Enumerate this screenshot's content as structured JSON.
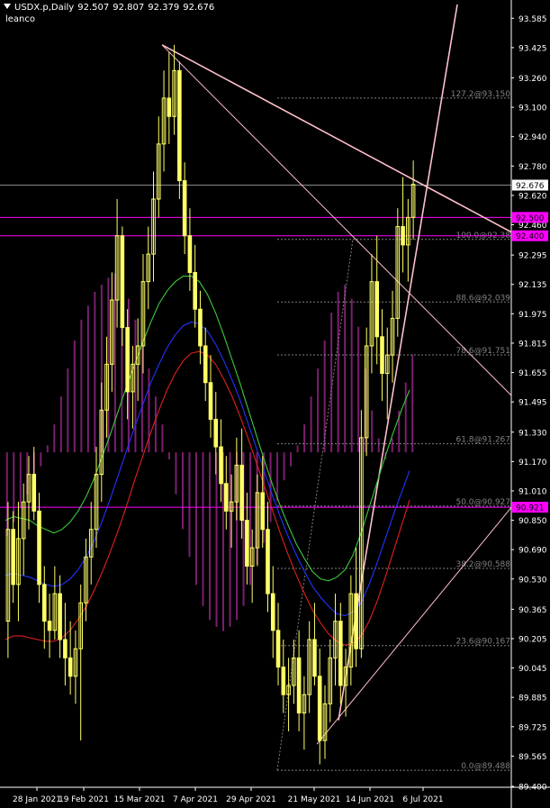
{
  "header": {
    "symbol": "USDX.p,Daily",
    "ohlc": [
      "92.507",
      "92.807",
      "92.379",
      "92.676"
    ],
    "indicator": "leanco"
  },
  "colors": {
    "background": "#000000",
    "candle": "#ffff66",
    "histogram": "#7a1f6e",
    "ma_fast": "#3cc83c",
    "ma_mid": "#2233ff",
    "ma_slow": "#e02020",
    "trendline": "#ffc0cb",
    "fib": "#808080",
    "hline": "#ff00ff",
    "axis": "#ffffff"
  },
  "chart_data": {
    "type": "candlestick",
    "title": "USDX.p,Daily",
    "xlabel": "",
    "ylabel": "",
    "ylim": [
      89.4,
      93.66
    ],
    "grid": false,
    "y_ticks": [
      "93.585",
      "93.425",
      "93.260",
      "93.100",
      "92.940",
      "92.780",
      "92.620",
      "92.460",
      "92.295",
      "92.135",
      "91.975",
      "91.815",
      "91.655",
      "91.495",
      "91.330",
      "91.170",
      "91.010",
      "90.850",
      "90.690",
      "90.530",
      "90.365",
      "90.205",
      "90.045",
      "89.885",
      "89.725",
      "89.565",
      "89.400"
    ],
    "x_ticks": [
      "28 Jan 2021",
      "19 Feb 2021",
      "15 Mar 2021",
      "7 Apr 2021",
      "29 Apr 2021",
      "21 May 2021",
      "14 Jun 2021",
      "6 Jul 2021"
    ],
    "current_price": "92.676",
    "price_lines": [
      {
        "label": "92.500",
        "value": 92.5
      },
      {
        "label": "92.400",
        "value": 92.4
      },
      {
        "label": "90.921",
        "value": 90.921
      }
    ],
    "fib_levels": [
      {
        "label": "127.2@93.150",
        "value": 93.15
      },
      {
        "label": "100.0@92.38",
        "value": 92.38
      },
      {
        "label": "88.6@92.039",
        "value": 92.039
      },
      {
        "label": "78.6@91.751",
        "value": 91.751
      },
      {
        "label": "61.8@91.267",
        "value": 91.267
      },
      {
        "label": "50.0@90.927",
        "value": 90.927
      },
      {
        "label": "38.2@90.588",
        "value": 90.588
      },
      {
        "label": "23.6@90.167",
        "value": 90.167
      },
      {
        "label": "0.0@89.488",
        "value": 89.488
      }
    ],
    "candles": [
      [
        90.3,
        90.95,
        90.1,
        90.8
      ],
      [
        90.8,
        90.9,
        90.4,
        90.5
      ],
      [
        90.5,
        90.95,
        90.3,
        90.75
      ],
      [
        90.75,
        91.05,
        90.55,
        90.95
      ],
      [
        90.95,
        91.2,
        90.8,
        91.1
      ],
      [
        91.1,
        91.25,
        90.85,
        90.9
      ],
      [
        90.9,
        91.0,
        90.4,
        90.5
      ],
      [
        90.5,
        90.6,
        90.15,
        90.3
      ],
      [
        90.3,
        90.45,
        90.1,
        90.25
      ],
      [
        90.25,
        90.6,
        90.2,
        90.45
      ],
      [
        90.45,
        90.55,
        90.1,
        90.2
      ],
      [
        90.2,
        90.4,
        89.95,
        90.1
      ],
      [
        90.1,
        90.3,
        89.9,
        90.0
      ],
      [
        90.0,
        90.25,
        89.85,
        90.15
      ],
      [
        90.15,
        90.5,
        89.65,
        90.4
      ],
      [
        90.4,
        90.75,
        90.3,
        90.65
      ],
      [
        90.65,
        90.95,
        90.5,
        90.8
      ],
      [
        90.8,
        91.25,
        90.7,
        91.1
      ],
      [
        91.1,
        91.6,
        90.95,
        91.45
      ],
      [
        91.45,
        91.85,
        91.3,
        91.7
      ],
      [
        91.7,
        92.2,
        91.55,
        92.05
      ],
      [
        92.05,
        92.6,
        91.9,
        92.4
      ],
      [
        92.4,
        92.45,
        91.8,
        91.9
      ],
      [
        91.9,
        92.0,
        91.4,
        91.55
      ],
      [
        91.55,
        91.8,
        91.35,
        91.7
      ],
      [
        91.7,
        91.95,
        91.5,
        91.8
      ],
      [
        91.8,
        92.3,
        91.65,
        92.15
      ],
      [
        92.15,
        92.45,
        92.0,
        92.3
      ],
      [
        92.3,
        92.75,
        92.15,
        92.6
      ],
      [
        92.6,
        93.05,
        92.5,
        92.9
      ],
      [
        92.9,
        93.3,
        92.75,
        93.15
      ],
      [
        93.15,
        93.4,
        92.9,
        93.05
      ],
      [
        93.05,
        93.44,
        92.95,
        93.3
      ],
      [
        93.3,
        93.35,
        92.6,
        92.7
      ],
      [
        92.7,
        92.8,
        92.3,
        92.4
      ],
      [
        92.4,
        92.55,
        92.1,
        92.2
      ],
      [
        92.2,
        92.35,
        91.9,
        92.0
      ],
      [
        92.0,
        92.1,
        91.7,
        91.8
      ],
      [
        91.8,
        91.9,
        91.5,
        91.6
      ],
      [
        91.6,
        91.75,
        91.3,
        91.4
      ],
      [
        91.4,
        91.55,
        91.1,
        91.25
      ],
      [
        91.25,
        91.4,
        90.95,
        91.05
      ],
      [
        91.05,
        91.2,
        90.8,
        90.9
      ],
      [
        90.9,
        91.1,
        90.7,
        90.95
      ],
      [
        90.95,
        91.3,
        90.85,
        91.15
      ],
      [
        91.15,
        91.35,
        90.75,
        90.85
      ],
      [
        90.85,
        91.0,
        90.5,
        90.6
      ],
      [
        90.6,
        90.8,
        90.4,
        90.7
      ],
      [
        90.7,
        91.1,
        90.6,
        91.0
      ],
      [
        91.0,
        91.2,
        90.7,
        90.8
      ],
      [
        90.8,
        90.95,
        90.35,
        90.45
      ],
      [
        90.45,
        90.6,
        90.1,
        90.25
      ],
      [
        90.25,
        90.4,
        89.95,
        90.05
      ],
      [
        90.05,
        90.2,
        89.8,
        89.9
      ],
      [
        89.9,
        90.1,
        89.7,
        89.95
      ],
      [
        89.95,
        90.2,
        89.85,
        90.1
      ],
      [
        90.1,
        90.25,
        89.7,
        89.8
      ],
      [
        89.8,
        90.0,
        89.6,
        89.9
      ],
      [
        89.9,
        90.3,
        89.8,
        90.2
      ],
      [
        90.2,
        90.4,
        89.95,
        90.0
      ],
      [
        90.0,
        90.15,
        89.52,
        89.65
      ],
      [
        89.65,
        89.95,
        89.55,
        89.85
      ],
      [
        89.85,
        90.2,
        89.75,
        90.1
      ],
      [
        90.1,
        90.45,
        89.95,
        90.3
      ],
      [
        90.3,
        90.4,
        89.85,
        89.95
      ],
      [
        89.95,
        90.15,
        89.78,
        90.05
      ],
      [
        90.05,
        90.55,
        89.95,
        90.45
      ],
      [
        90.45,
        90.7,
        90.05,
        90.15
      ],
      [
        90.15,
        91.45,
        90.1,
        91.3
      ],
      [
        91.3,
        91.9,
        91.2,
        91.8
      ],
      [
        91.8,
        92.3,
        91.65,
        92.15
      ],
      [
        92.15,
        92.4,
        91.7,
        91.85
      ],
      [
        91.85,
        92.0,
        91.5,
        91.65
      ],
      [
        91.65,
        91.9,
        91.4,
        91.75
      ],
      [
        91.75,
        92.1,
        91.6,
        91.95
      ],
      [
        91.95,
        92.55,
        91.85,
        92.45
      ],
      [
        92.45,
        92.72,
        92.2,
        92.35
      ],
      [
        92.35,
        92.6,
        92.15,
        92.5
      ],
      [
        92.5,
        92.81,
        92.38,
        92.68
      ]
    ],
    "series": [
      {
        "values": [
          90.85,
          90.87,
          90.86,
          90.85,
          90.82,
          90.8,
          90.78,
          90.8,
          90.84,
          90.9,
          90.98,
          91.08,
          91.2,
          91.32,
          91.45,
          91.58,
          91.7,
          91.82,
          91.93,
          92.03,
          92.1,
          92.15,
          92.18,
          92.18,
          92.15,
          92.08,
          91.98,
          91.86,
          91.73,
          91.6,
          91.46,
          91.32,
          91.18,
          91.05,
          90.93,
          90.82,
          90.72,
          90.64,
          90.57,
          90.53,
          90.52,
          90.54,
          90.58,
          90.66,
          90.78,
          90.92,
          91.06,
          91.2,
          91.33,
          91.45,
          91.56
        ]
      },
      {
        "values": [
          90.55,
          90.56,
          90.55,
          90.54,
          90.52,
          90.5,
          90.49,
          90.5,
          90.53,
          90.58,
          90.65,
          90.74,
          90.85,
          90.97,
          91.1,
          91.23,
          91.36,
          91.48,
          91.6,
          91.7,
          91.79,
          91.86,
          91.91,
          91.93,
          91.92,
          91.88,
          91.81,
          91.72,
          91.62,
          91.51,
          91.38,
          91.25,
          91.12,
          90.99,
          90.87,
          90.76,
          90.66,
          90.57,
          90.49,
          90.43,
          90.38,
          90.34,
          90.33,
          90.35,
          90.4,
          90.5,
          90.62,
          90.75,
          90.88,
          91.0,
          91.12
        ]
      },
      {
        "values": [
          90.2,
          90.22,
          90.22,
          90.21,
          90.2,
          90.19,
          90.19,
          90.21,
          90.25,
          90.31,
          90.38,
          90.47,
          90.57,
          90.68,
          90.8,
          90.93,
          91.07,
          91.2,
          91.33,
          91.45,
          91.56,
          91.65,
          91.72,
          91.76,
          91.77,
          91.75,
          91.7,
          91.62,
          91.53,
          91.42,
          91.3,
          91.17,
          91.04,
          90.91,
          90.78,
          90.66,
          90.55,
          90.45,
          90.36,
          90.29,
          90.23,
          90.19,
          90.17,
          90.18,
          90.22,
          90.3,
          90.41,
          90.54,
          90.68,
          90.82,
          90.96
        ]
      }
    ],
    "histogram": [
      -0.6,
      -0.5,
      -0.4,
      -0.3,
      -0.2,
      -0.1,
      0.05,
      0.2,
      0.4,
      0.6,
      0.8,
      0.95,
      1.05,
      1.15,
      1.2,
      1.25,
      1.28,
      1.2,
      1.1,
      0.95,
      0.8,
      0.6,
      0.4,
      0.2,
      -0.05,
      -0.3,
      -0.55,
      -0.75,
      -0.95,
      -1.1,
      -1.2,
      -1.25,
      -1.28,
      -1.25,
      -1.2,
      -1.1,
      -0.95,
      -0.8,
      -0.65,
      -0.5,
      -0.35,
      -0.2,
      -0.1,
      0.05,
      0.2,
      0.4,
      0.6,
      0.8,
      1.0,
      1.15,
      1.2,
      1.1,
      0.9,
      0.6,
      0.3,
      0.1,
      -0.05,
      0.1,
      0.3,
      0.5,
      0.7
    ]
  }
}
